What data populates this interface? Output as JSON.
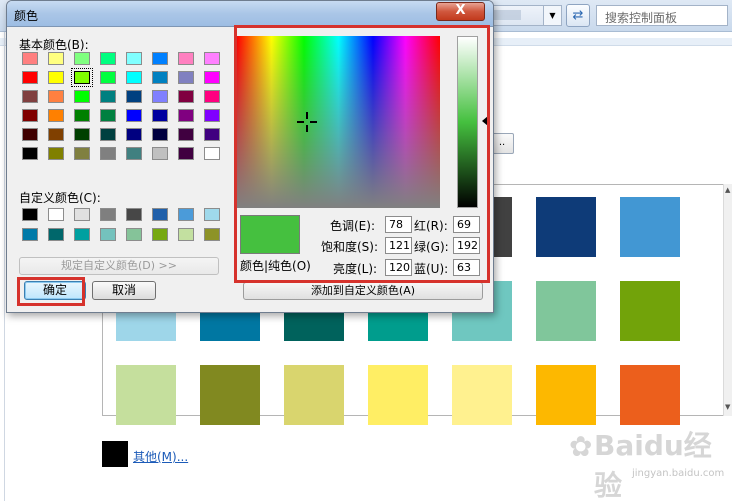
{
  "background": {
    "search_placeholder": "搜索控制面板",
    "more_link": "其他(M)...",
    "small_button_label": "..",
    "watermark_brand": "Baidu经验",
    "watermark_url": "jingyan.baidu.com",
    "swatches": [
      {
        "row": 0,
        "col": 4,
        "color": "#414141"
      },
      {
        "row": 0,
        "col": 5,
        "color": "#0e3b78"
      },
      {
        "row": 0,
        "col": 6,
        "color": "#4297d3"
      },
      {
        "row": 1,
        "col": 0,
        "color": "#9ed6e9"
      },
      {
        "row": 1,
        "col": 1,
        "color": "#0077a2"
      },
      {
        "row": 1,
        "col": 2,
        "color": "#00625c"
      },
      {
        "row": 1,
        "col": 3,
        "color": "#009d8d"
      },
      {
        "row": 1,
        "col": 4,
        "color": "#6fc7c0"
      },
      {
        "row": 1,
        "col": 5,
        "color": "#80c69b"
      },
      {
        "row": 1,
        "col": 6,
        "color": "#72a30a"
      },
      {
        "row": 2,
        "col": 0,
        "color": "#c5df9d"
      },
      {
        "row": 2,
        "col": 1,
        "color": "#818920"
      },
      {
        "row": 2,
        "col": 2,
        "color": "#d9d56e"
      },
      {
        "row": 2,
        "col": 3,
        "color": "#ffee64"
      },
      {
        "row": 2,
        "col": 4,
        "color": "#fff18f"
      },
      {
        "row": 2,
        "col": 5,
        "color": "#fdb800"
      },
      {
        "row": 2,
        "col": 6,
        "color": "#ec5f1c"
      }
    ]
  },
  "dialog": {
    "title": "颜色",
    "close_label": "X",
    "basic_colors_label": "基本颜色(B):",
    "custom_colors_label": "自定义颜色(C):",
    "define_custom_button": "规定自定义颜色(D) >>",
    "ok_button": "确定",
    "cancel_button": "取消",
    "add_custom_button": "添加到自定义颜色(A)",
    "color_solid_label": "颜色|纯色(O)",
    "hue_label": "色调(E):",
    "hue_value": "78",
    "sat_label": "饱和度(S):",
    "sat_value": "121",
    "lum_label": "亮度(L):",
    "lum_value": "120",
    "red_label": "红(R):",
    "red_value": "69",
    "green_label": "绿(G):",
    "green_value": "192",
    "blue_label": "蓝(U):",
    "blue_value": "63",
    "current_color": "#45c03f",
    "selected_basic_index": 10,
    "basic_colors": [
      "#ff8080",
      "#ffff80",
      "#80ff80",
      "#00ff80",
      "#80ffff",
      "#0080ff",
      "#ff80c0",
      "#ff80ff",
      "#ff0000",
      "#ffff00",
      "#80ff00",
      "#00ff40",
      "#00ffff",
      "#0080c0",
      "#8080c0",
      "#ff00ff",
      "#804040",
      "#ff8040",
      "#00ff00",
      "#008080",
      "#004080",
      "#8080ff",
      "#800040",
      "#ff0080",
      "#800000",
      "#ff8000",
      "#008000",
      "#008040",
      "#0000ff",
      "#0000a0",
      "#800080",
      "#8000ff",
      "#400000",
      "#804000",
      "#004000",
      "#004040",
      "#000080",
      "#000040",
      "#400040",
      "#400080",
      "#000000",
      "#808000",
      "#808040",
      "#808080",
      "#408080",
      "#c0c0c0",
      "#400040",
      "#ffffff"
    ],
    "custom_colors": [
      "#000000",
      "#ffffff",
      "#e0e0e0",
      "#7f7f7f",
      "#474747",
      "#1f5faa",
      "#4b9bd9",
      "#9fd9eb",
      "#007aa8",
      "#00676b",
      "#00a0a0",
      "#74c2bd",
      "#85c399",
      "#76a810",
      "#c3e0a0",
      "#8d9327"
    ]
  }
}
